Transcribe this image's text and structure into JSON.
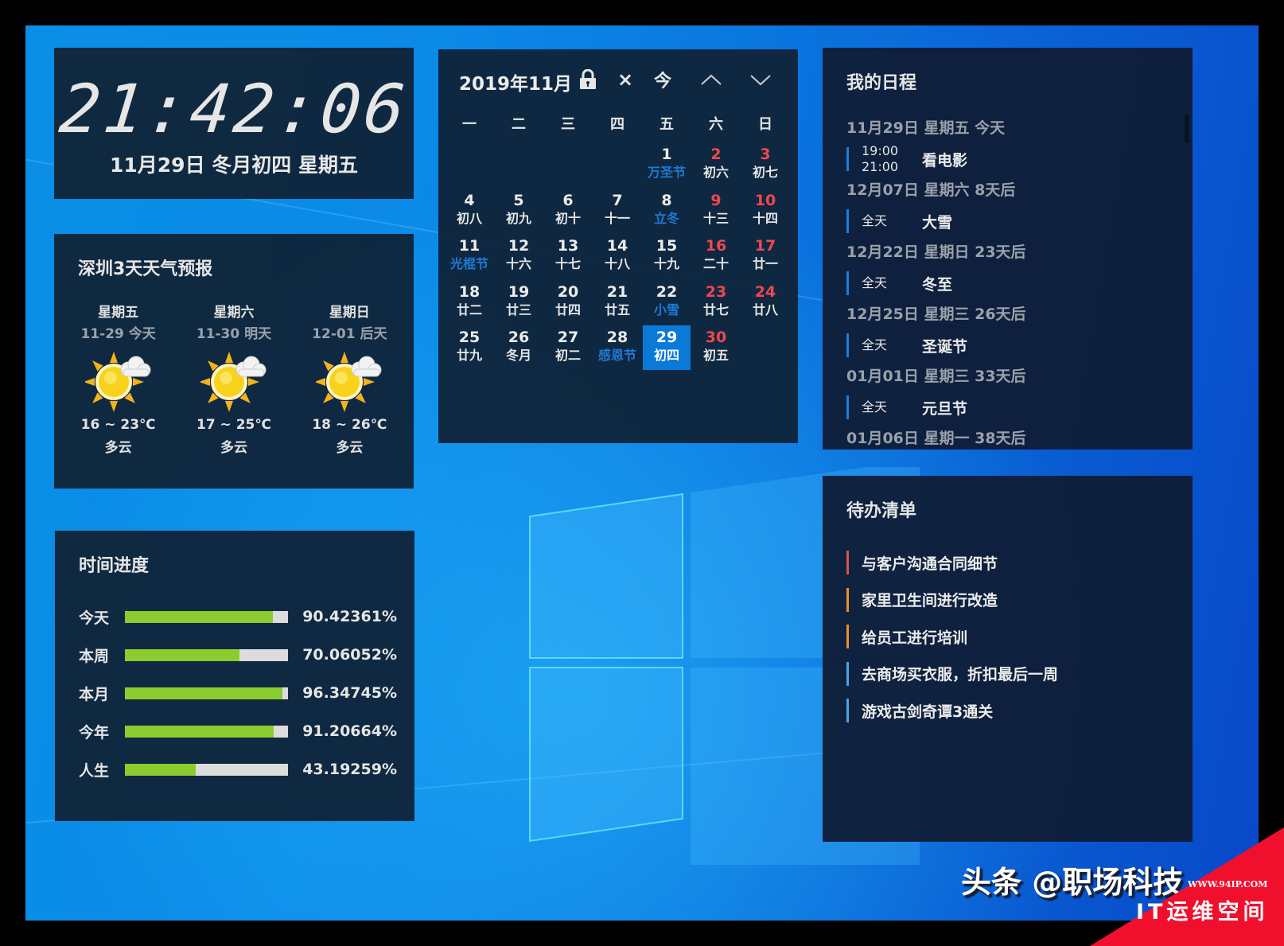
{
  "clock": {
    "time": "21:42:06",
    "date": "11月29日 冬月初四 星期五"
  },
  "weather": {
    "title": "深圳3天天气预报",
    "days": [
      {
        "weekday": "星期五",
        "date": "11-29 今天",
        "icon": "partly-cloudy-icon",
        "temp": "16 ~ 23℃",
        "condition": "多云"
      },
      {
        "weekday": "星期六",
        "date": "11-30 明天",
        "icon": "partly-cloudy-icon",
        "temp": "17 ~ 25℃",
        "condition": "多云"
      },
      {
        "weekday": "星期日",
        "date": "12-01 后天",
        "icon": "partly-cloudy-icon",
        "temp": "18 ~ 26℃",
        "condition": "多云"
      }
    ]
  },
  "progress": {
    "title": "时间进度",
    "rows": [
      {
        "label": "今天",
        "percent": 90.42361,
        "text": "90.42361%"
      },
      {
        "label": "本周",
        "percent": 70.06052,
        "text": "70.06052%"
      },
      {
        "label": "本月",
        "percent": 96.34745,
        "text": "96.34745%"
      },
      {
        "label": "今年",
        "percent": 91.20664,
        "text": "91.20664%"
      },
      {
        "label": "人生",
        "percent": 43.19259,
        "text": "43.19259%"
      }
    ],
    "fill_color": "#8ccc2e",
    "track_color": "#dcdcdc"
  },
  "calendar": {
    "title": "2019年11月",
    "buttons": {
      "lock": "lock-icon",
      "close": "×",
      "today": "今",
      "prev": "prev-month",
      "next": "next-month"
    },
    "weekdays": [
      "一",
      "二",
      "三",
      "四",
      "五",
      "六",
      "日"
    ],
    "leading_blanks": 4,
    "days": [
      {
        "n": "1",
        "l": "万圣节",
        "hol": true,
        "we": false
      },
      {
        "n": "2",
        "l": "初六",
        "hol": false,
        "we": true
      },
      {
        "n": "3",
        "l": "初七",
        "hol": false,
        "we": true
      },
      {
        "n": "4",
        "l": "初八",
        "hol": false,
        "we": false
      },
      {
        "n": "5",
        "l": "初九",
        "hol": false,
        "we": false
      },
      {
        "n": "6",
        "l": "初十",
        "hol": false,
        "we": false
      },
      {
        "n": "7",
        "l": "十一",
        "hol": false,
        "we": false
      },
      {
        "n": "8",
        "l": "立冬",
        "hol": true,
        "we": false
      },
      {
        "n": "9",
        "l": "十三",
        "hol": false,
        "we": true
      },
      {
        "n": "10",
        "l": "十四",
        "hol": false,
        "we": true
      },
      {
        "n": "11",
        "l": "光棍节",
        "hol": true,
        "we": false
      },
      {
        "n": "12",
        "l": "十六",
        "hol": false,
        "we": false
      },
      {
        "n": "13",
        "l": "十七",
        "hol": false,
        "we": false
      },
      {
        "n": "14",
        "l": "十八",
        "hol": false,
        "we": false
      },
      {
        "n": "15",
        "l": "十九",
        "hol": false,
        "we": false
      },
      {
        "n": "16",
        "l": "二十",
        "hol": false,
        "we": true
      },
      {
        "n": "17",
        "l": "廿一",
        "hol": false,
        "we": true
      },
      {
        "n": "18",
        "l": "廿二",
        "hol": false,
        "we": false
      },
      {
        "n": "19",
        "l": "廿三",
        "hol": false,
        "we": false
      },
      {
        "n": "20",
        "l": "廿四",
        "hol": false,
        "we": false
      },
      {
        "n": "21",
        "l": "廿五",
        "hol": false,
        "we": false
      },
      {
        "n": "22",
        "l": "小雪",
        "hol": true,
        "we": false
      },
      {
        "n": "23",
        "l": "廿七",
        "hol": false,
        "we": true
      },
      {
        "n": "24",
        "l": "廿八",
        "hol": false,
        "we": true
      },
      {
        "n": "25",
        "l": "廿九",
        "hol": false,
        "we": false
      },
      {
        "n": "26",
        "l": "冬月",
        "hol": false,
        "we": false
      },
      {
        "n": "27",
        "l": "初二",
        "hol": false,
        "we": false
      },
      {
        "n": "28",
        "l": "感恩节",
        "hol": true,
        "we": false
      },
      {
        "n": "29",
        "l": "初四",
        "hol": false,
        "we": false,
        "today": true
      },
      {
        "n": "30",
        "l": "初五",
        "hol": false,
        "we": true
      }
    ],
    "colors": {
      "weekend": "#f0474f",
      "holiday": "#1e7ad6",
      "today_bg": "#0b79d8"
    }
  },
  "schedule": {
    "title": "我的日程",
    "groups": [
      {
        "date": "11月29日 星期五 今天",
        "events": [
          {
            "time": "19:00\n21:00",
            "title": "看电影"
          }
        ]
      },
      {
        "date": "12月07日 星期六 8天后",
        "events": [
          {
            "time": "全天",
            "title": "大雪"
          }
        ]
      },
      {
        "date": "12月22日 星期日 23天后",
        "events": [
          {
            "time": "全天",
            "title": "冬至"
          }
        ]
      },
      {
        "date": "12月25日 星期三 26天后",
        "events": [
          {
            "time": "全天",
            "title": "圣诞节"
          }
        ]
      },
      {
        "date": "01月01日 星期三 33天后",
        "events": [
          {
            "time": "全天",
            "title": "元旦节"
          }
        ]
      },
      {
        "date": "01月06日 星期一 38天后",
        "events": []
      }
    ],
    "accent": "#1a7ee0"
  },
  "todo": {
    "title": "待办清单",
    "items": [
      {
        "text": "与客户沟通合同细节",
        "color": "#d9534f"
      },
      {
        "text": "家里卫生间进行改造",
        "color": "#e8902a"
      },
      {
        "text": "给员工进行培训",
        "color": "#e8902a"
      },
      {
        "text": "去商场买衣服，折扣最后一周",
        "color": "#4aa3ea"
      },
      {
        "text": "游戏古剑奇谭3通关",
        "color": "#4aa3ea"
      }
    ]
  },
  "watermarks": {
    "toutiao": "头条 @职场科技",
    "site_url": "WWW.94IP.COM",
    "site_name": "IT运维空间"
  }
}
